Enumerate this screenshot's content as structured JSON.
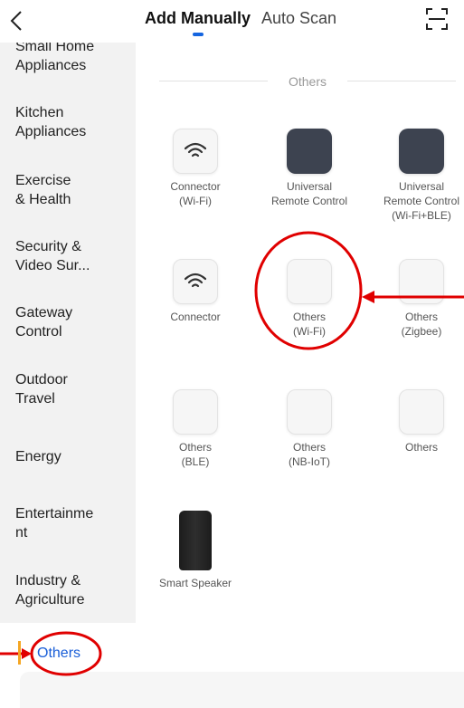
{
  "header": {
    "back_icon": "chevron-left-icon",
    "tabs": [
      "Add Manually",
      "Auto Scan"
    ],
    "scan_icon": "scan-frame-icon"
  },
  "sidebar": {
    "categories": [
      "Small Home\nAppliances",
      "Kitchen\nAppliances",
      "Exercise\n& Health",
      "Security &\nVideo Sur...",
      "Gateway\nControl",
      "Outdoor\nTravel",
      "Energy",
      "Entertainme\nnt",
      "Industry &\nAgriculture",
      "Others"
    ]
  },
  "section": {
    "title": "Others"
  },
  "devices": [
    {
      "name": "Connector\n(Wi-Fi)",
      "icon": "wifi-icon"
    },
    {
      "name": "Universal\nRemote Control",
      "icon": "remote-dark-tile"
    },
    {
      "name": "Universal\nRemote Control\n(Wi-Fi+BLE)",
      "icon": "remote-dark-tile"
    },
    {
      "name": "Connector",
      "icon": "wifi-icon"
    },
    {
      "name": "Others\n(Wi-Fi)",
      "icon": "blank-tile"
    },
    {
      "name": "Others\n(Zigbee)",
      "icon": "blank-tile"
    },
    {
      "name": "Others\n(BLE)",
      "icon": "blank-tile"
    },
    {
      "name": "Others\n(NB-IoT)",
      "icon": "blank-tile"
    },
    {
      "name": "Others",
      "icon": "blank-tile"
    },
    {
      "name": "Smart Speaker",
      "icon": "speaker-icon"
    }
  ],
  "colors": {
    "accent": "#1565e0",
    "annotation": "#e00000",
    "sidebar_bg": "#f2f2f2"
  }
}
